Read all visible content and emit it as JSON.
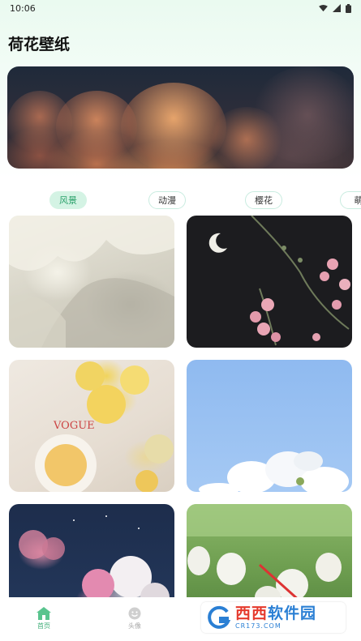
{
  "status_bar": {
    "time": "10:06",
    "icons": [
      "wifi-icon",
      "signal-icon",
      "battery-icon"
    ]
  },
  "app": {
    "title": "荷花壁纸"
  },
  "category_tabs": [
    {
      "label": "风景",
      "active": true
    },
    {
      "label": "动漫",
      "active": false
    },
    {
      "label": "樱花",
      "active": false
    },
    {
      "label": "萌",
      "active": false
    }
  ],
  "bottom_nav": {
    "items": [
      {
        "label": "首页",
        "icon": "home-icon",
        "active": true
      },
      {
        "label": "头像",
        "icon": "smiley-icon",
        "active": false
      }
    ]
  },
  "watermark": {
    "main_part1": "西西",
    "main_part2": "软件园",
    "sub": "CR173.COM"
  },
  "colors": {
    "accent": "#3fae78",
    "tab_active_bg": "#d4f3e4",
    "tab_border": "#c9ece0"
  }
}
